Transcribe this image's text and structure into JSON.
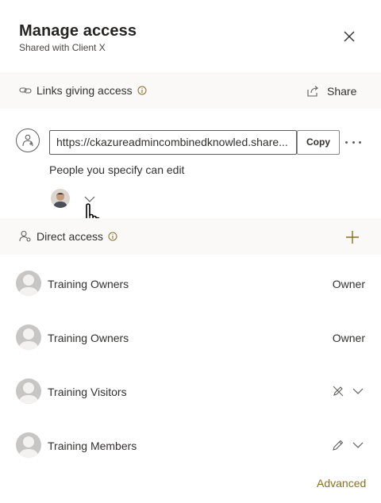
{
  "header": {
    "title": "Manage access",
    "subtitle": "Shared with Client X"
  },
  "links_section": {
    "label": "Links giving access",
    "share_label": "Share",
    "link_url": "https://ckazureadmincombinedknowled.share...",
    "copy_label": "Copy",
    "permission_text": "People you specify can edit"
  },
  "direct_section": {
    "label": "Direct access"
  },
  "members": [
    {
      "name": "Training Owners",
      "role": "Owner"
    },
    {
      "name": "Training Owners",
      "role": "Owner"
    },
    {
      "name": "Training Visitors",
      "role": "",
      "role_icon": "no-edit-icon"
    },
    {
      "name": "Training Members",
      "role": "",
      "role_icon": "edit-icon"
    }
  ],
  "footer": {
    "advanced_label": "Advanced"
  },
  "colors": {
    "section_bg": "#faf9f8",
    "accent": "#8a6f23",
    "avatar_gray": "#c8c6c4"
  }
}
